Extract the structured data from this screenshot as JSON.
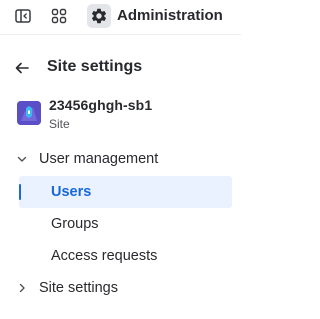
{
  "topbar": {
    "title": "Administration",
    "icons": {
      "sidebar_toggle": "sidebar-toggle-icon",
      "app_switcher": "app-switcher-icon",
      "settings": "gear-icon"
    }
  },
  "page": {
    "title": "Site settings",
    "back_icon": "arrow-left-icon"
  },
  "site": {
    "name": "23456ghgh-sb1",
    "type": "Site",
    "logo_color": "#5b4fc7"
  },
  "nav": {
    "groups": [
      {
        "label": "User management",
        "expanded": true,
        "items": [
          {
            "label": "Users",
            "selected": true
          },
          {
            "label": "Groups",
            "selected": false
          },
          {
            "label": "Access requests",
            "selected": false
          }
        ]
      },
      {
        "label": "Site settings",
        "expanded": false,
        "items": []
      }
    ]
  },
  "colors": {
    "accent": "#1868db",
    "selected_bg": "#e9f2fe",
    "text": "#292a2e",
    "subtle_text": "#505258"
  }
}
